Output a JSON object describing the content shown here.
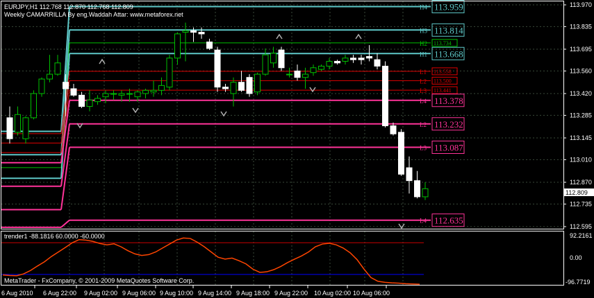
{
  "header": {
    "symbol_line": "EURJPY,H1  112.768 112.870 112.768 112.809",
    "indicator_title": "Weekly CAMARRILLA By eng.Waddah Attar: www.metaforex.net"
  },
  "colors": {
    "background": "#000000",
    "grid": "#3a4a3a",
    "bull_candle": "#00c000",
    "bear_candle": "#ffffff",
    "h_line": "#00c000",
    "hb_line": "#5ec8c8",
    "l_line": "#e00000",
    "lb_line": "#ff3399",
    "osc_line": "#ff4500",
    "osc_upper": "#c80000",
    "osc_lower": "#0000ff",
    "fractal": "#b0b0b0"
  },
  "price_axis": {
    "ticks": [
      "113.970",
      "113.835",
      "113.695",
      "113.560",
      "113.420",
      "113.285",
      "113.145",
      "113.010",
      "112.870",
      "112.735",
      "112.595"
    ],
    "current_price": "112.809"
  },
  "time_axis": {
    "ticks": [
      "6 Aug 2010",
      "6 Aug 22:00",
      "9 Aug 02:00",
      "9 Aug 06:00",
      "9 Aug 10:00",
      "9 Aug 14:00",
      "9 Aug 18:00",
      "9 Aug 22:00",
      "10 Aug 02:00",
      "10 Aug 06:00"
    ]
  },
  "levels": [
    {
      "tag": "H4",
      "price": "113.959",
      "kind": "hb"
    },
    {
      "tag": "H3",
      "price": "113.814",
      "kind": "hb"
    },
    {
      "tag": "H2",
      "price": "113.734",
      "kind": "h"
    },
    {
      "tag": "H1",
      "price": "113.668",
      "kind": "hb"
    },
    {
      "tag": "L1",
      "price": "113.558",
      "kind": "l"
    },
    {
      "tag": "L2",
      "price": "113.500",
      "kind": "l"
    },
    {
      "tag": "L3",
      "price": "113.441",
      "kind": "l"
    },
    {
      "tag": "L4",
      "price": "113.378",
      "kind": "lb"
    },
    {
      "tag": "L2",
      "price": "113.232",
      "kind": "lb"
    },
    {
      "tag": "L3",
      "price": "113.087",
      "kind": "lb"
    },
    {
      "tag": "L4",
      "price": "112.635",
      "kind": "lb"
    }
  ],
  "indicator": {
    "label": "trender1 -88.1816 60.0000 -60.0000",
    "ticks": [
      "92.2161",
      "0.00",
      "-96.7719"
    ],
    "footer": "MetaTrader - FxCompany, © 2001-2009 MetaQuotes Software Corp."
  },
  "candles": [
    [
      113.27,
      113.34,
      113.11,
      113.14
    ],
    [
      113.18,
      113.34,
      113.16,
      113.29
    ],
    [
      113.14,
      113.28,
      113.11,
      113.27
    ],
    [
      113.27,
      113.44,
      113.26,
      113.42
    ],
    [
      113.42,
      113.52,
      113.4,
      113.51
    ],
    [
      113.51,
      113.66,
      113.49,
      113.54
    ],
    [
      113.54,
      113.66,
      113.53,
      113.61
    ],
    [
      113.49,
      113.54,
      113.28,
      113.45
    ],
    [
      113.45,
      113.48,
      113.4,
      113.41
    ],
    [
      113.41,
      113.43,
      113.33,
      113.34
    ],
    [
      113.34,
      113.44,
      113.31,
      113.38
    ],
    [
      113.37,
      113.41,
      113.35,
      113.39
    ],
    [
      113.4,
      113.44,
      113.36,
      113.42
    ],
    [
      113.42,
      113.44,
      113.38,
      113.42
    ],
    [
      113.41,
      113.44,
      113.37,
      113.42
    ],
    [
      113.42,
      113.45,
      113.37,
      113.42
    ],
    [
      113.4,
      113.44,
      113.37,
      113.43
    ],
    [
      113.42,
      113.45,
      113.39,
      113.44
    ],
    [
      113.43,
      113.5,
      113.4,
      113.44
    ],
    [
      113.44,
      113.52,
      113.41,
      113.47
    ],
    [
      113.46,
      113.66,
      113.44,
      113.64
    ],
    [
      113.64,
      113.8,
      113.6,
      113.79
    ],
    [
      113.8,
      113.86,
      113.62,
      113.81
    ],
    [
      113.81,
      113.83,
      113.74,
      113.8
    ],
    [
      113.8,
      113.83,
      113.76,
      113.79
    ],
    [
      113.74,
      113.76,
      113.69,
      113.7
    ],
    [
      113.69,
      113.71,
      113.43,
      113.46
    ],
    [
      113.46,
      113.48,
      113.43,
      113.45
    ],
    [
      113.42,
      113.52,
      113.34,
      113.49
    ],
    [
      113.49,
      113.56,
      113.43,
      113.44
    ],
    [
      113.52,
      113.54,
      113.4,
      113.42
    ],
    [
      113.43,
      113.55,
      113.41,
      113.54
    ],
    [
      113.54,
      113.7,
      113.53,
      113.66
    ],
    [
      113.61,
      113.71,
      113.58,
      113.67
    ],
    [
      113.69,
      113.71,
      113.56,
      113.58
    ],
    [
      113.54,
      113.58,
      113.52,
      113.54
    ],
    [
      113.56,
      113.6,
      113.5,
      113.52
    ],
    [
      113.52,
      113.58,
      113.45,
      113.54
    ],
    [
      113.55,
      113.6,
      113.53,
      113.58
    ],
    [
      113.57,
      113.6,
      113.56,
      113.59
    ],
    [
      113.59,
      113.64,
      113.57,
      113.62
    ],
    [
      113.62,
      113.63,
      113.6,
      113.61
    ],
    [
      113.62,
      113.66,
      113.6,
      113.64
    ],
    [
      113.64,
      113.66,
      113.61,
      113.63
    ],
    [
      113.64,
      113.66,
      113.6,
      113.63
    ],
    [
      113.65,
      113.72,
      113.62,
      113.64
    ],
    [
      113.63,
      113.67,
      113.57,
      113.59
    ],
    [
      113.59,
      113.62,
      113.21,
      113.22
    ],
    [
      113.22,
      113.24,
      113.16,
      113.17
    ],
    [
      113.18,
      113.2,
      112.91,
      112.92
    ],
    [
      112.96,
      113.03,
      112.8,
      112.88
    ],
    [
      112.88,
      112.94,
      112.77,
      112.78
    ],
    [
      112.78,
      112.87,
      112.76,
      112.83
    ]
  ],
  "oscillator": [
    -62,
    -64,
    -65,
    -58,
    -45,
    -28,
    -12,
    8,
    25,
    42,
    60,
    72,
    70,
    65,
    57,
    52,
    56,
    45,
    30,
    18,
    12,
    15,
    25,
    40,
    55,
    70,
    78,
    76,
    62,
    45,
    25,
    5,
    -2,
    2,
    -8,
    -20,
    -40,
    -52,
    -50,
    -42,
    -30,
    -15,
    -2,
    10,
    25,
    45,
    55,
    58,
    52,
    40,
    22,
    -4,
    -40,
    -72,
    -86,
    -90,
    -92,
    -93,
    -95,
    -96,
    -97
  ]
}
